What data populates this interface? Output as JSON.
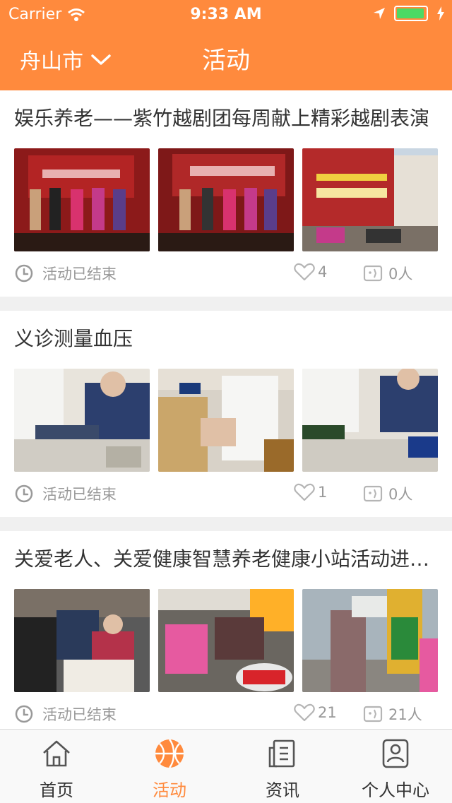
{
  "status_bar": {
    "carrier": "Carrier",
    "time": "9:33 AM"
  },
  "nav": {
    "city": "舟山市",
    "title": "活动"
  },
  "activities": [
    {
      "title": "娱乐养老——紫竹越剧团每周献上精彩越剧表演",
      "status": "活动已结束",
      "likes": "4",
      "participants": "0人"
    },
    {
      "title": "义诊测量血压",
      "status": "活动已结束",
      "likes": "1",
      "participants": "0人"
    },
    {
      "title": "关爱老人、关爱健康智慧养老健康小站活动进社区",
      "status": "活动已结束",
      "likes": "21",
      "participants": "21人"
    }
  ],
  "tabs": [
    {
      "label": "首页",
      "icon": "home-icon"
    },
    {
      "label": "活动",
      "icon": "basketball-icon",
      "active": true
    },
    {
      "label": "资讯",
      "icon": "news-icon"
    },
    {
      "label": "个人中心",
      "icon": "profile-icon"
    }
  ],
  "colors": {
    "accent": "#ff8a3d",
    "battery": "#4cd964",
    "meta_text": "#999999"
  }
}
